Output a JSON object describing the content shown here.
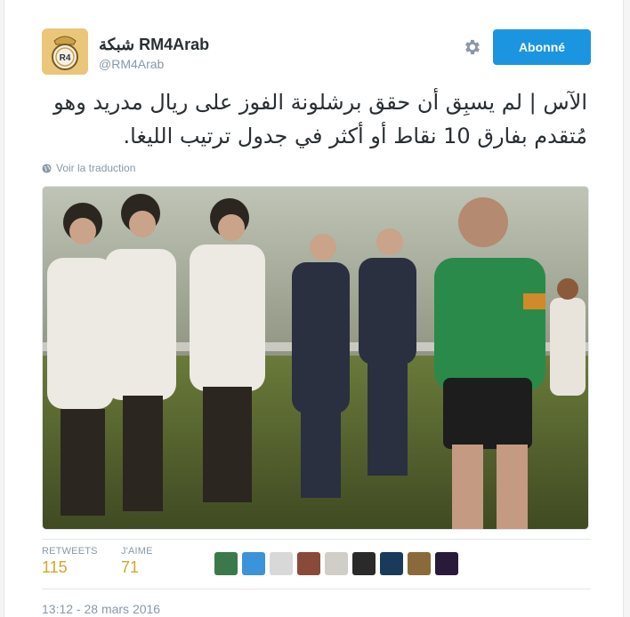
{
  "user": {
    "display_name": "شبكة RM4Arab",
    "handle": "@RM4Arab"
  },
  "follow_button": {
    "label": "Abonné"
  },
  "tweet": {
    "text": "الآس | لم يسبِق أن حقق برشلونة الفوز على ريال مدريد وهو مُتقدم بفارق 10 نقاط أو أكثر في جدول ترتيب الليغا."
  },
  "translate_link": {
    "label": "Voir la traduction"
  },
  "stats": {
    "retweets_label": "RETWEETS",
    "retweets_value": "115",
    "likes_label": "J'AIME",
    "likes_value": "71"
  },
  "likers_count": 9,
  "timestamp": "13:12 - 28 mars 2016",
  "colors": {
    "accent": "#1b95e0",
    "stat_value": "#d2a72a"
  },
  "icons": [
    "gear-icon",
    "globe-icon"
  ]
}
